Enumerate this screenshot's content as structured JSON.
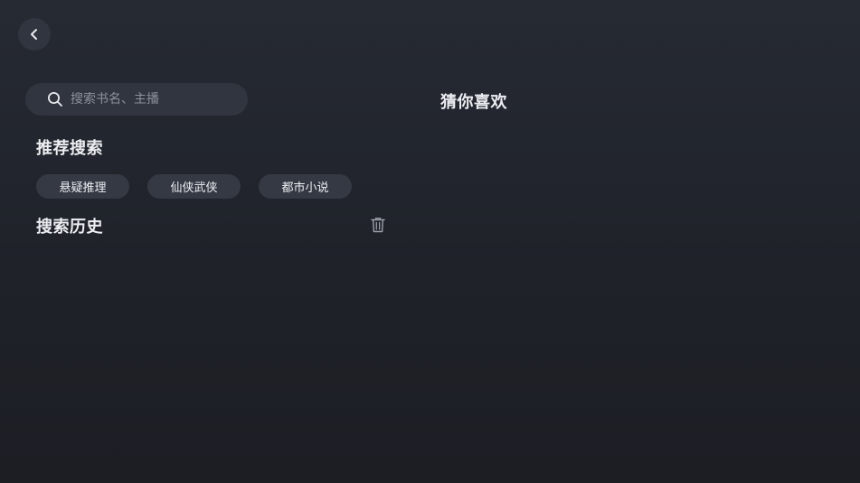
{
  "header": {
    "back_icon": "chevron-left-icon"
  },
  "search": {
    "placeholder": "搜索书名、主播",
    "value": "",
    "icon": "search-icon"
  },
  "recommended": {
    "title": "推荐搜索",
    "tags": [
      {
        "label": "悬疑推理"
      },
      {
        "label": "仙侠武侠"
      },
      {
        "label": "都市小说"
      }
    ]
  },
  "history": {
    "title": "搜索历史",
    "clear_icon": "trash-icon",
    "items": []
  },
  "guess": {
    "title": "猜你喜欢"
  },
  "colors": {
    "background": "#23262e",
    "surface": "#31353f",
    "chip": "#353944",
    "text": "#eceef2",
    "placeholder": "#8d919b"
  }
}
